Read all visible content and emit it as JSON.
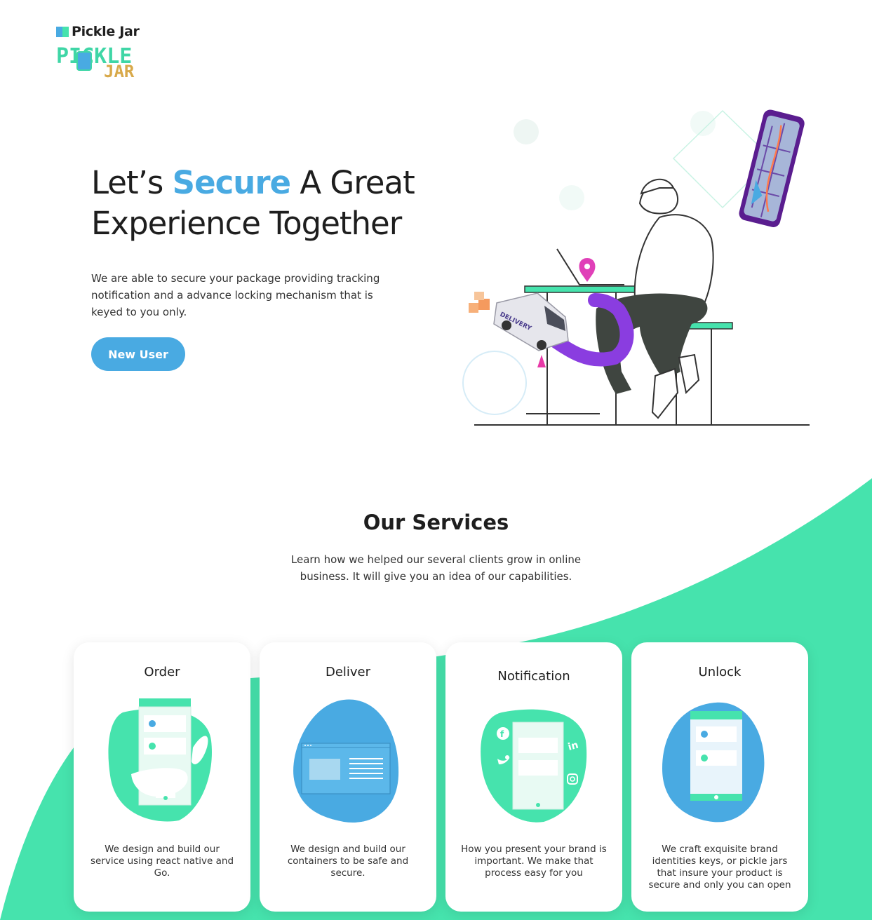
{
  "brand": {
    "name": "Pickle Jar",
    "logo_text_top": "PICKLE",
    "logo_text_bottom": "JAR"
  },
  "hero": {
    "title_before": "Let’s ",
    "title_accent": "Secure",
    "title_after": " A Great",
    "title_line2": "Experience Together",
    "description": "We are able to secure your package providing tracking notification and a advance locking mechanism that is keyed to you only.",
    "cta_label": "New User",
    "illustration_van_label": "DELIVERY"
  },
  "services": {
    "title": "Our Services",
    "description": "Learn how we helped our several clients grow in online business. It will give you an idea of our capabilities.",
    "cards": [
      {
        "title": "Order",
        "text": "We design and build our service using react native and Go.",
        "icon": "hand-holding-phone-icon"
      },
      {
        "title": "Deliver",
        "text": "We design and build our containers to be safe and secure.",
        "icon": "browser-window-icon"
      },
      {
        "title": "Notification",
        "text": "How you present your brand is important. We make that process easy for you",
        "icon": "phone-social-icons-icon"
      },
      {
        "title": "Unlock",
        "text": "We craft exquisite brand identities keys, or pickle jars that insure your product is secure and only you can open",
        "icon": "phone-checklist-icon"
      }
    ]
  },
  "colors": {
    "accent_blue": "#49aae2",
    "mint_green": "#46e3ad",
    "logo_gold": "#d8a94a",
    "text_dark": "#1e1e1e"
  }
}
